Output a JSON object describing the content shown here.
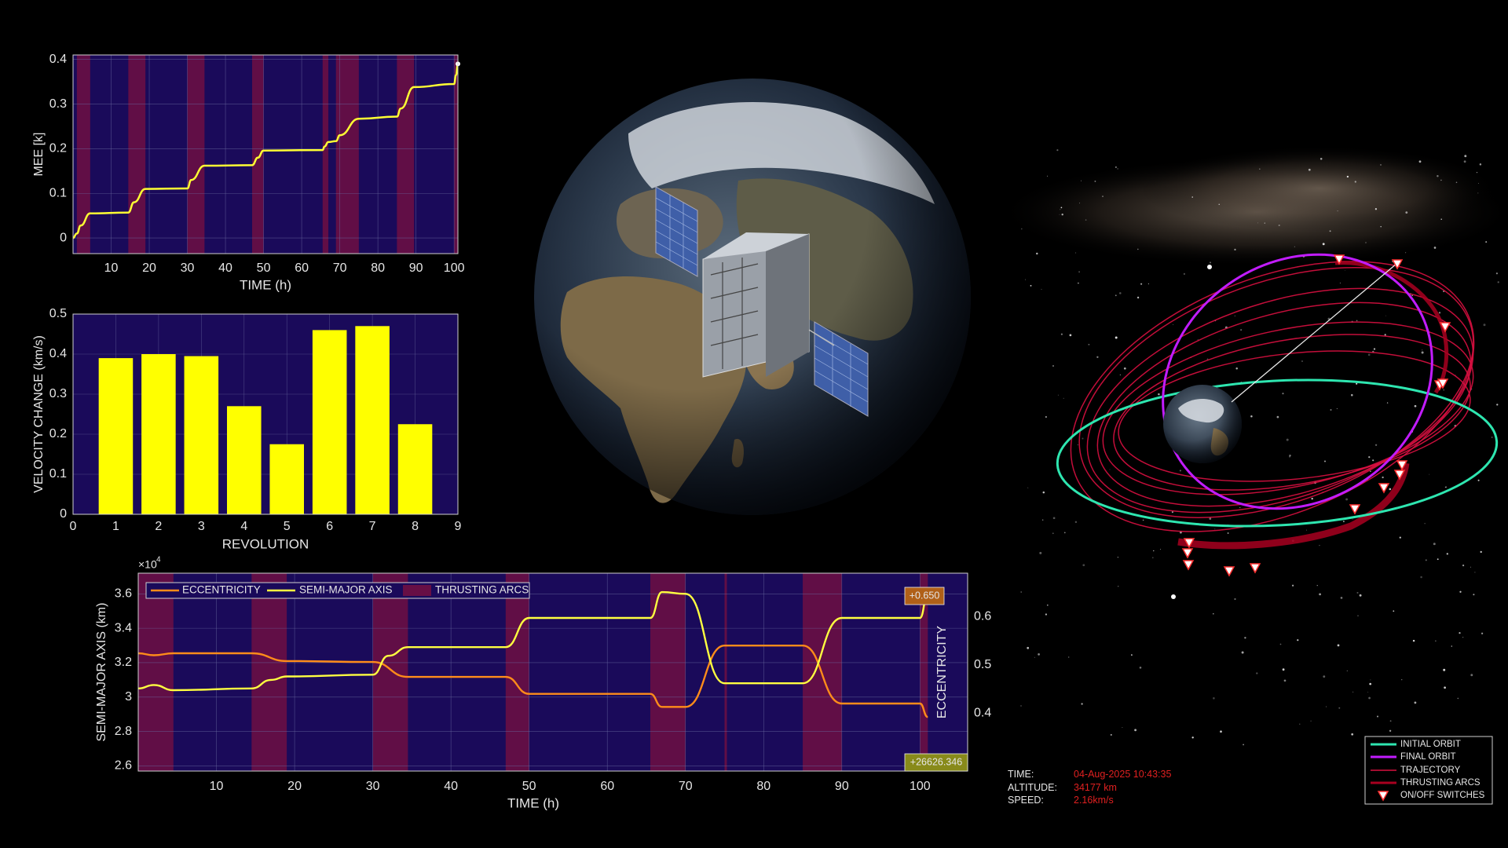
{
  "chart_data": [
    {
      "type": "line",
      "ylabel": "MEE [k]",
      "xlabel": "TIME (h)",
      "xlim": [
        0,
        101
      ],
      "ylim": [
        -0.035,
        0.41
      ],
      "xticks": [
        10,
        20,
        30,
        40,
        50,
        60,
        70,
        80,
        90,
        100
      ],
      "yticks": [
        0,
        0.1,
        0.2,
        0.3,
        0.4
      ],
      "ytick_labels": [
        "0",
        "0.1",
        "0.2",
        "0.3",
        "0.4"
      ],
      "grid": true,
      "background": "#1a0a5a",
      "line_color": "#ffff33",
      "thrust_band_color": "#7a1040",
      "thrusting_arcs": [
        [
          1,
          4.5
        ],
        [
          14.5,
          19
        ],
        [
          30,
          34.5
        ],
        [
          47,
          50
        ],
        [
          65.5,
          67
        ],
        [
          69,
          75
        ],
        [
          85,
          89.5
        ],
        [
          100,
          101
        ]
      ],
      "x": [
        0,
        1,
        2,
        4.5,
        14.5,
        16,
        19,
        30,
        31,
        34.5,
        47,
        48.5,
        50,
        65.5,
        66,
        67,
        69,
        70,
        75,
        85,
        86,
        89.5,
        100,
        100.5,
        101
      ],
      "y": [
        0,
        0.01,
        0.028,
        0.055,
        0.057,
        0.08,
        0.11,
        0.111,
        0.13,
        0.162,
        0.163,
        0.18,
        0.196,
        0.197,
        0.205,
        0.215,
        0.217,
        0.23,
        0.267,
        0.272,
        0.29,
        0.338,
        0.345,
        0.365,
        0.39
      ]
    },
    {
      "type": "bar",
      "ylabel": "VELOCITY CHANGE (km/s)",
      "xlabel": "REVOLUTION",
      "xlim": [
        0,
        9
      ],
      "ylim": [
        0,
        0.5
      ],
      "xticks": [
        0,
        1,
        2,
        3,
        4,
        5,
        6,
        7,
        8,
        9
      ],
      "yticks": [
        0,
        0.1,
        0.2,
        0.3,
        0.4,
        0.5
      ],
      "ytick_labels": [
        "0",
        "0.1",
        "0.2",
        "0.3",
        "0.4",
        "0.5"
      ],
      "grid": true,
      "background": "#1a0a5a",
      "bar_color": "#ffff00",
      "categories": [
        1,
        2,
        3,
        4,
        5,
        6,
        7,
        8
      ],
      "values": [
        0.39,
        0.4,
        0.395,
        0.27,
        0.175,
        0.46,
        0.47,
        0.225
      ]
    },
    {
      "type": "line",
      "xlabel": "TIME (h)",
      "ylabel_left": "SEMI-MAJOR AXIS (km)",
      "ylabel_right": "ECCENTRICITY",
      "exponent_label": "×10",
      "exponent_power": "4",
      "xlim": [
        0,
        101
      ],
      "ylim_left": [
        2.57,
        3.72
      ],
      "ylim_right": [
        0.28,
        0.69
      ],
      "xticks": [
        10,
        20,
        30,
        40,
        50,
        60,
        70,
        80,
        90,
        100
      ],
      "yticks_left": [
        2.6,
        2.8,
        3,
        3.2,
        3.4,
        3.6
      ],
      "ytick_labels_left": [
        "2.6",
        "2.8",
        "3",
        "3.2",
        "3.4",
        "3.6"
      ],
      "yticks_right": [
        0.4,
        0.5,
        0.6
      ],
      "ytick_labels_right": [
        "0.4",
        "0.5",
        "0.6"
      ],
      "grid": true,
      "background": "#1a0a5a",
      "thrust_band_color": "#7a1040",
      "thrusting_arcs": [
        [
          0,
          4.5
        ],
        [
          14.5,
          19
        ],
        [
          30,
          34.5
        ],
        [
          47,
          50
        ],
        [
          65.5,
          70
        ],
        [
          75,
          75.3
        ],
        [
          85,
          90
        ],
        [
          100,
          101
        ]
      ],
      "legend": {
        "position": "top",
        "entries": [
          "ECCENTRICITY",
          "SEMI-MAJOR AXIS",
          "THRUSTING ARCS"
        ]
      },
      "series": [
        {
          "name": "ECCENTRICITY",
          "axis": "right",
          "color": "#ff8c1a",
          "x": [
            0,
            2,
            4.5,
            14.5,
            19,
            30,
            34.5,
            47,
            50,
            65.5,
            67,
            70,
            75,
            85,
            90,
            100,
            101
          ],
          "y": [
            0.524,
            0.52,
            0.524,
            0.524,
            0.508,
            0.506,
            0.475,
            0.475,
            0.44,
            0.44,
            0.413,
            0.413,
            0.54,
            0.54,
            0.42,
            0.42,
            0.392
          ]
        },
        {
          "name": "SEMI-MAJOR AXIS",
          "axis": "left",
          "color": "#ffff40",
          "x": [
            0,
            2,
            4.5,
            14.5,
            17,
            19,
            30,
            32,
            34.5,
            47,
            50,
            65.5,
            67,
            70,
            75,
            85,
            90,
            100,
            101
          ],
          "y": [
            3.05,
            3.07,
            3.04,
            3.05,
            3.1,
            3.12,
            3.13,
            3.24,
            3.29,
            3.29,
            3.46,
            3.46,
            3.61,
            3.6,
            3.08,
            3.08,
            3.46,
            3.46,
            3.6
          ]
        }
      ],
      "end_labels": {
        "eccentricity": "+0.650",
        "semi_major_axis": "+26626.346"
      }
    }
  ],
  "orbit_legend": [
    "INITIAL ORBIT",
    "FINAL ORBIT",
    "TRAJECTORY",
    "THRUSTING ARCS",
    "ON/OFF SWITCHES"
  ],
  "colors": {
    "initial_orbit": "#2ee6b0",
    "final_orbit": "#c21cff",
    "trajectory": "#d81040",
    "thrusting_arcs": "#a80020",
    "switch_marker": "#ff3030"
  },
  "status": {
    "time_label": "TIME:",
    "time_value": "04-Aug-2025 10:43:35",
    "altitude_label": "ALTITUDE:",
    "altitude_value": "34177 km",
    "speed_label": "SPEED:",
    "speed_value": "2.16km/s"
  }
}
